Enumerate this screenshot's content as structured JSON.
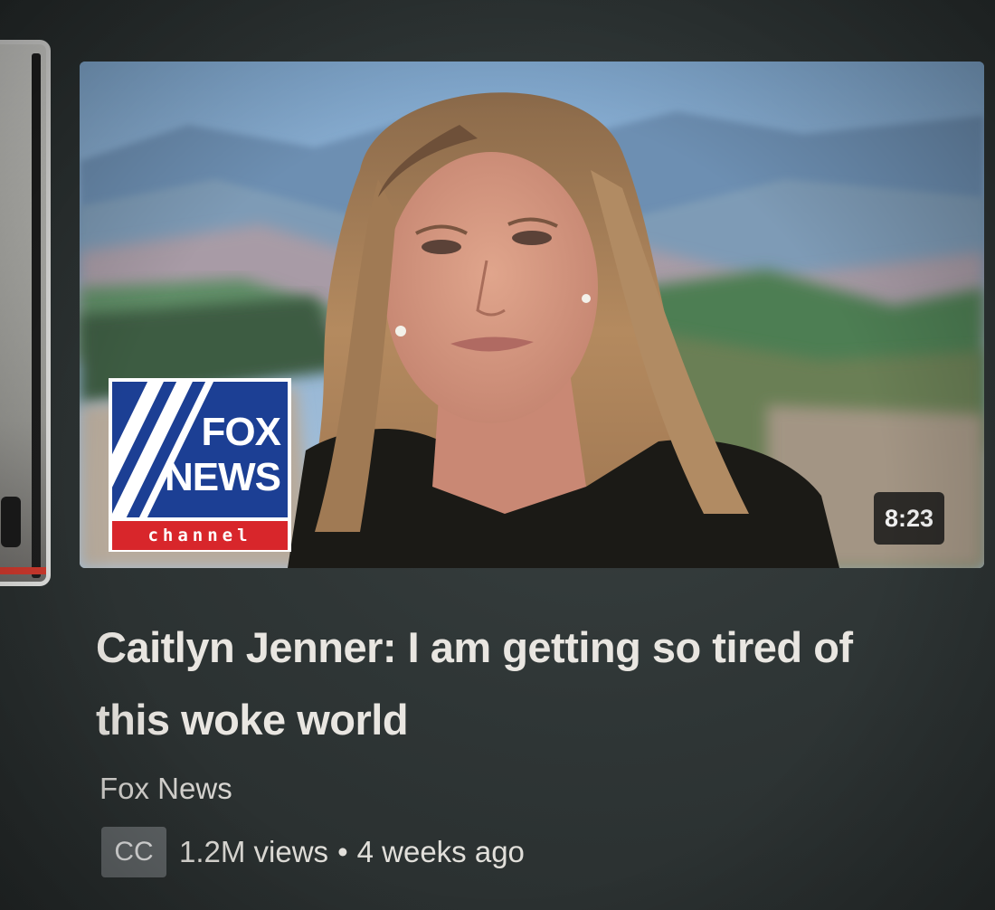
{
  "video": {
    "title": "Caitlyn Jenner: I am getting so tired of this woke world",
    "channel": "Fox News",
    "duration": "8:23",
    "captions_badge": "CC",
    "views": "1.2M views",
    "separator": "•",
    "published": "4 weeks ago"
  },
  "thumbnail": {
    "logo": {
      "word_one": "FOX",
      "word_two": "NEWS",
      "tagline": "channel"
    }
  },
  "colors": {
    "background": "#2f3636",
    "title_text": "#e9e6e1",
    "logo_blue": "#1c3f94",
    "logo_red": "#d8262b",
    "progress_red": "#d23a2e"
  }
}
